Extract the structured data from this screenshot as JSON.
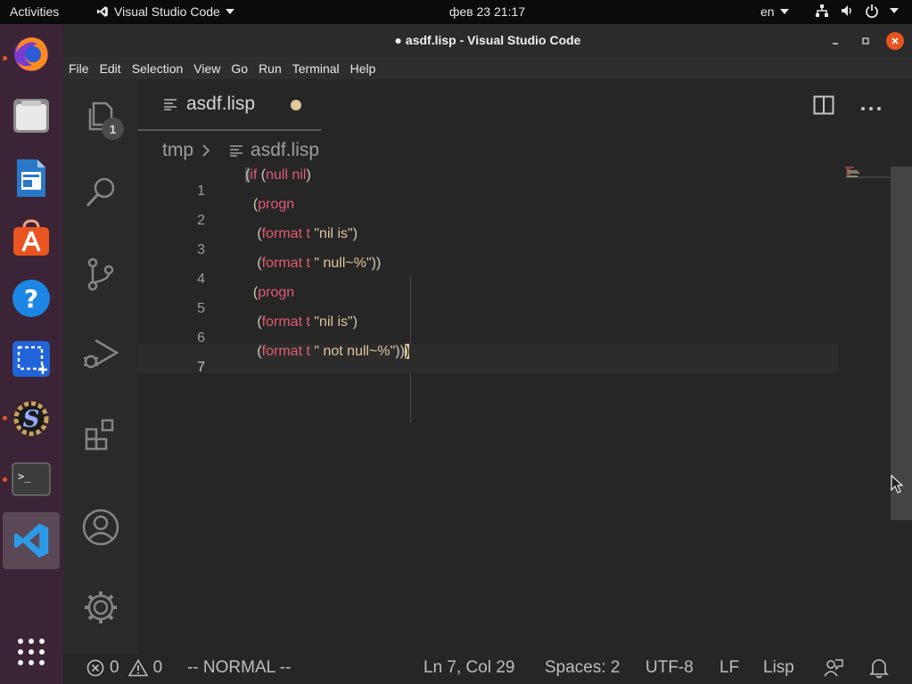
{
  "topbar": {
    "activities": "Activities",
    "app_menu": "Visual Studio Code",
    "clock": "фев 23  21:17",
    "lang": "en"
  },
  "window": {
    "title": "asdf.lisp - Visual Studio Code"
  },
  "menu": {
    "items": [
      "File",
      "Edit",
      "Selection",
      "View",
      "Go",
      "Run",
      "Terminal",
      "Help"
    ]
  },
  "activity_bar": {
    "explorer_badge": "1"
  },
  "tab": {
    "label": "asdf.lisp"
  },
  "breadcrumb": {
    "folder": "tmp",
    "file": "asdf.lisp"
  },
  "editor": {
    "line_numbers": [
      "1",
      "2",
      "3",
      "4",
      "5",
      "6",
      "7"
    ],
    "lines": [
      "(if (null nil)",
      "  (progn",
      "   (format t \"nil is\")",
      "   (format t \" null~%\"))",
      "  (progn",
      "   (format t \"nil is\")",
      "   (format t \" not null~%\")))"
    ],
    "current_line": 7
  },
  "status": {
    "errors": "0",
    "warnings": "0",
    "mode": "-- NORMAL --",
    "position": "Ln 7, Col 29",
    "spaces": "Spaces: 2",
    "encoding": "UTF-8",
    "eol": "LF",
    "language": "Lisp"
  },
  "colors": {
    "keyword": "#e15b73",
    "string": "#e2c79b",
    "paren": "#d0c9b8",
    "accent": "#e95420"
  }
}
